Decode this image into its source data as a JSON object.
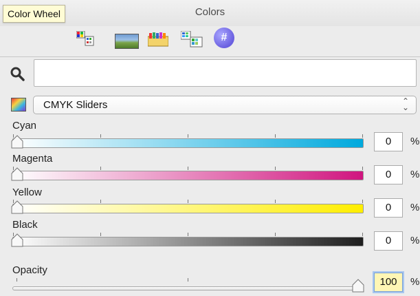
{
  "window": {
    "title": "Colors"
  },
  "toolbar": {
    "tooltip": "Color Wheel",
    "hex_symbol": "#"
  },
  "search": {
    "value": "",
    "placeholder": ""
  },
  "mode": {
    "selected": "CMYK Sliders",
    "arrows": "⌃⌄"
  },
  "sliders": [
    {
      "label": "Cyan",
      "value": "0",
      "unit": "%",
      "level": 0
    },
    {
      "label": "Magenta",
      "value": "0",
      "unit": "%",
      "level": 0
    },
    {
      "label": "Yellow",
      "value": "0",
      "unit": "%",
      "level": 0
    },
    {
      "label": "Black",
      "value": "0",
      "unit": "%",
      "level": 0
    }
  ],
  "opacity": {
    "label": "Opacity",
    "value": "100",
    "unit": "%",
    "level": 1.0
  },
  "colors": {
    "cyan": "#00a9dd",
    "magenta": "#d0157f",
    "yellow": "#ffee00",
    "black": "#1e1e1e",
    "tooltip_bg": "#fffcd5"
  }
}
